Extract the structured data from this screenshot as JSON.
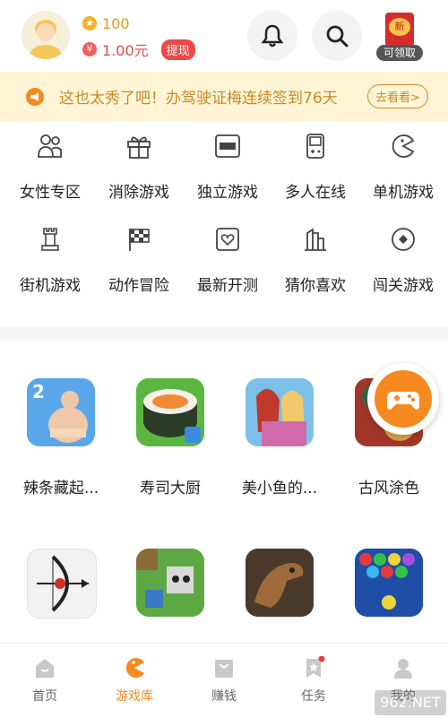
{
  "header": {
    "coins": "100",
    "money": "1.00元",
    "withdraw_label": "提现",
    "redpack_badge": "新",
    "redpack_tag": "可领取"
  },
  "notice": {
    "text": "这也太秀了吧！办驾驶证梅连续签到76天",
    "more_label": "去看看>"
  },
  "categories": [
    {
      "label": "女性专区",
      "icon": "people-icon"
    },
    {
      "label": "消除游戏",
      "icon": "gift-icon"
    },
    {
      "label": "独立游戏",
      "icon": "new-icon"
    },
    {
      "label": "多人在线",
      "icon": "gameboy-icon"
    },
    {
      "label": "单机游戏",
      "icon": "pacman-icon"
    },
    {
      "label": "街机游戏",
      "icon": "chess-rook-icon"
    },
    {
      "label": "动作冒险",
      "icon": "checkered-flag-icon"
    },
    {
      "label": "最新开测",
      "icon": "heart-card-icon"
    },
    {
      "label": "猜你喜欢",
      "icon": "building-icon"
    },
    {
      "label": "闯关游戏",
      "icon": "target-icon"
    }
  ],
  "games_row1": [
    {
      "name": "辣条藏起...",
      "icon": "spicy-strip-game-icon"
    },
    {
      "name": "寿司大厨",
      "icon": "sushi-game-icon"
    },
    {
      "name": "美小鱼的...",
      "icon": "mermaid-game-icon"
    },
    {
      "name": "古风涂色",
      "icon": "ancient-coloring-game-icon"
    }
  ],
  "games_row2": [
    {
      "icon": "archery-game-icon"
    },
    {
      "icon": "block-craft-game-icon"
    },
    {
      "icon": "dinosaur-game-icon"
    },
    {
      "icon": "bubble-shooter-game-icon"
    }
  ],
  "tabs": [
    {
      "label": "首页",
      "icon": "home-icon",
      "active": false
    },
    {
      "label": "游戏库",
      "icon": "pacman-icon",
      "active": true
    },
    {
      "label": "赚钱",
      "icon": "wallet-icon",
      "active": false
    },
    {
      "label": "任务",
      "icon": "task-icon",
      "active": false
    },
    {
      "label": "我的",
      "icon": "user-icon",
      "active": false
    }
  ],
  "watermark": "962.NET",
  "colors": {
    "accent": "#f6891f",
    "notice_bg": "#fff5d6",
    "notice_text": "#c98a22",
    "money": "#e24a4a"
  }
}
